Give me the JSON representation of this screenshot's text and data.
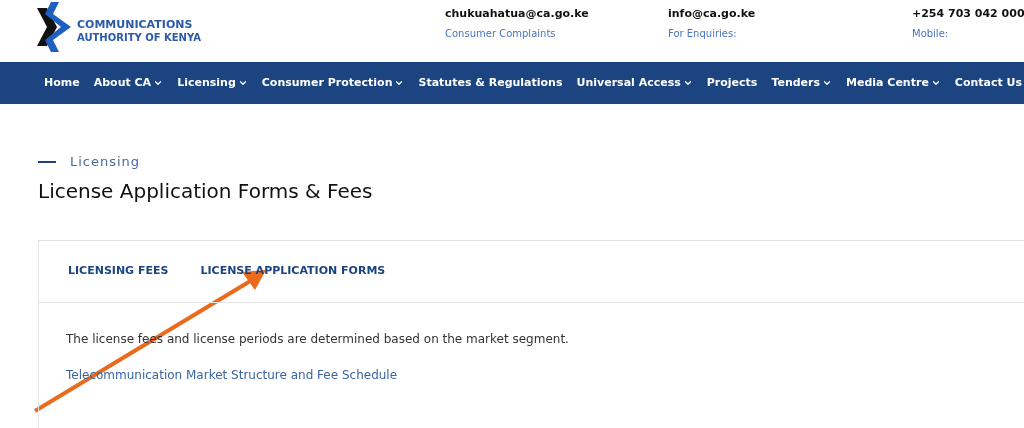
{
  "header": {
    "logo": {
      "line_1": "COMMUNICATIONS",
      "line_2": "AUTHORITY OF KENYA"
    },
    "contacts": [
      {
        "value": "chukuahatua@ca.go.ke",
        "label": "Consumer Complaints"
      },
      {
        "value": "info@ca.go.ke",
        "label": "For Enquiries:"
      },
      {
        "value": "+254 703 042 000",
        "label": "Mobile:"
      }
    ]
  },
  "nav": [
    {
      "label": "Home",
      "has_menu": false
    },
    {
      "label": "About CA",
      "has_menu": true
    },
    {
      "label": "Licensing",
      "has_menu": true
    },
    {
      "label": "Consumer Protection",
      "has_menu": true
    },
    {
      "label": "Statutes & Regulations",
      "has_menu": false
    },
    {
      "label": "Universal Access",
      "has_menu": true
    },
    {
      "label": "Projects",
      "has_menu": false
    },
    {
      "label": "Tenders",
      "has_menu": true
    },
    {
      "label": "Media Centre",
      "has_menu": true
    },
    {
      "label": "Contact Us",
      "has_menu": false
    }
  ],
  "page": {
    "eyebrow": "Licensing",
    "title": "License Application Forms & Fees"
  },
  "tabs": [
    {
      "label": "LICENSING FEES"
    },
    {
      "label": "LICENSE APPLICATION FORMS"
    }
  ],
  "body": {
    "text": "The license fees and license periods are determined based on the market segment.",
    "link": "Telecommunication Market Structure and Fee Schedule"
  }
}
